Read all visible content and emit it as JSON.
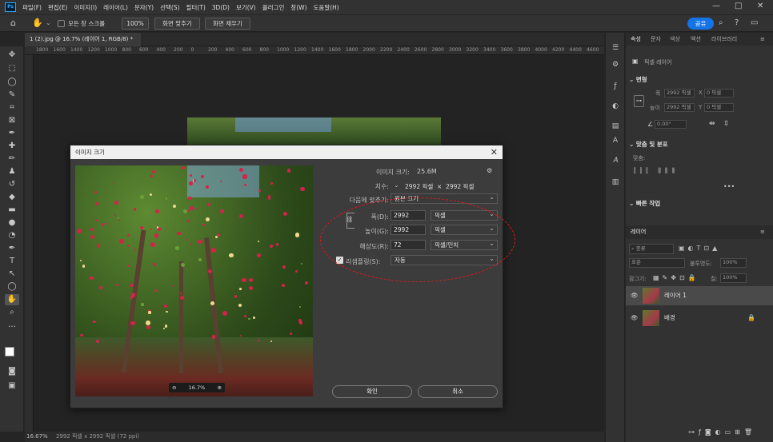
{
  "app": {
    "logo": "Ps",
    "menus": [
      "파일(F)",
      "편집(E)",
      "이미지(I)",
      "레이어(L)",
      "문자(Y)",
      "선택(S)",
      "필터(T)",
      "3D(D)",
      "보기(V)",
      "플러그인",
      "창(W)",
      "도움말(H)"
    ],
    "win_controls": [
      "—",
      "□",
      "✕"
    ]
  },
  "options": {
    "scroll_all": "모든 창 스크롤",
    "zoom": "100%",
    "fit_screen": "화면 맞추기",
    "fill_screen": "화면 채우기",
    "share": "공유"
  },
  "document": {
    "tab": "1 (2).jpg @ 16.7% (레이어 1, RGB/8) *",
    "ruler": [
      "1800",
      "1600",
      "1400",
      "1200",
      "1000",
      "800",
      "600",
      "400",
      "200",
      "0",
      "200",
      "400",
      "600",
      "800",
      "1000",
      "1200",
      "1400",
      "1600",
      "1800",
      "2000",
      "2200",
      "2400",
      "2600",
      "2800",
      "3000",
      "3200",
      "3400",
      "3600",
      "3800",
      "4000",
      "4200",
      "4400",
      "4600"
    ]
  },
  "status": {
    "zoom": "16.67%",
    "info": "2992 픽셀 x 2992 픽셀 (72 ppi)"
  },
  "panel": {
    "tabs": [
      "속성",
      "문자",
      "색상",
      "액션",
      "라이브러리"
    ],
    "pixel_layer": "픽셀 레이어",
    "transform": {
      "title": "변형",
      "w_label": "폭",
      "w_val": "2992 픽셀",
      "x_label": "X",
      "x_val": "0 픽셀",
      "h_label": "높이",
      "h_val": "2992 픽셀",
      "y_label": "Y",
      "y_val": "0 픽셀",
      "angle": "0.00°"
    },
    "align": {
      "title": "맞춤 및 분포",
      "sub": "맞춤:",
      "more": "•••"
    },
    "quick": {
      "title": "빠른 작업"
    },
    "layers": {
      "tab": "레이어",
      "kind": "종류",
      "blend": "표준",
      "opacity_label": "불투명도:",
      "opacity": "100%",
      "lock_label": "잠그기:",
      "fill_label": "칠:",
      "fill": "100%",
      "items": [
        {
          "name": "레이어 1"
        },
        {
          "name": "배경"
        }
      ]
    }
  },
  "dialog": {
    "title": "이미지 크기",
    "size_label": "이미지 크기:",
    "size_val": "25.6M",
    "dim_label": "치수:",
    "dim_val": "2992 픽셀  ×  2992 픽셀",
    "fit_label": "다음에 맞추기:",
    "fit_val": "원본 크기",
    "width_label": "폭(D):",
    "width_val": "2992",
    "width_unit": "픽셀",
    "height_label": "높이(G):",
    "height_val": "2992",
    "height_unit": "픽셀",
    "res_label": "해상도(R):",
    "res_val": "72",
    "res_unit": "픽셀/인치",
    "resample_label": "리샘플링(S):",
    "resample_val": "자동",
    "zoom": "16.7%",
    "ok": "확인",
    "cancel": "취소"
  },
  "colors": {
    "accent": "#1473e6",
    "annotation": "#e01818"
  }
}
